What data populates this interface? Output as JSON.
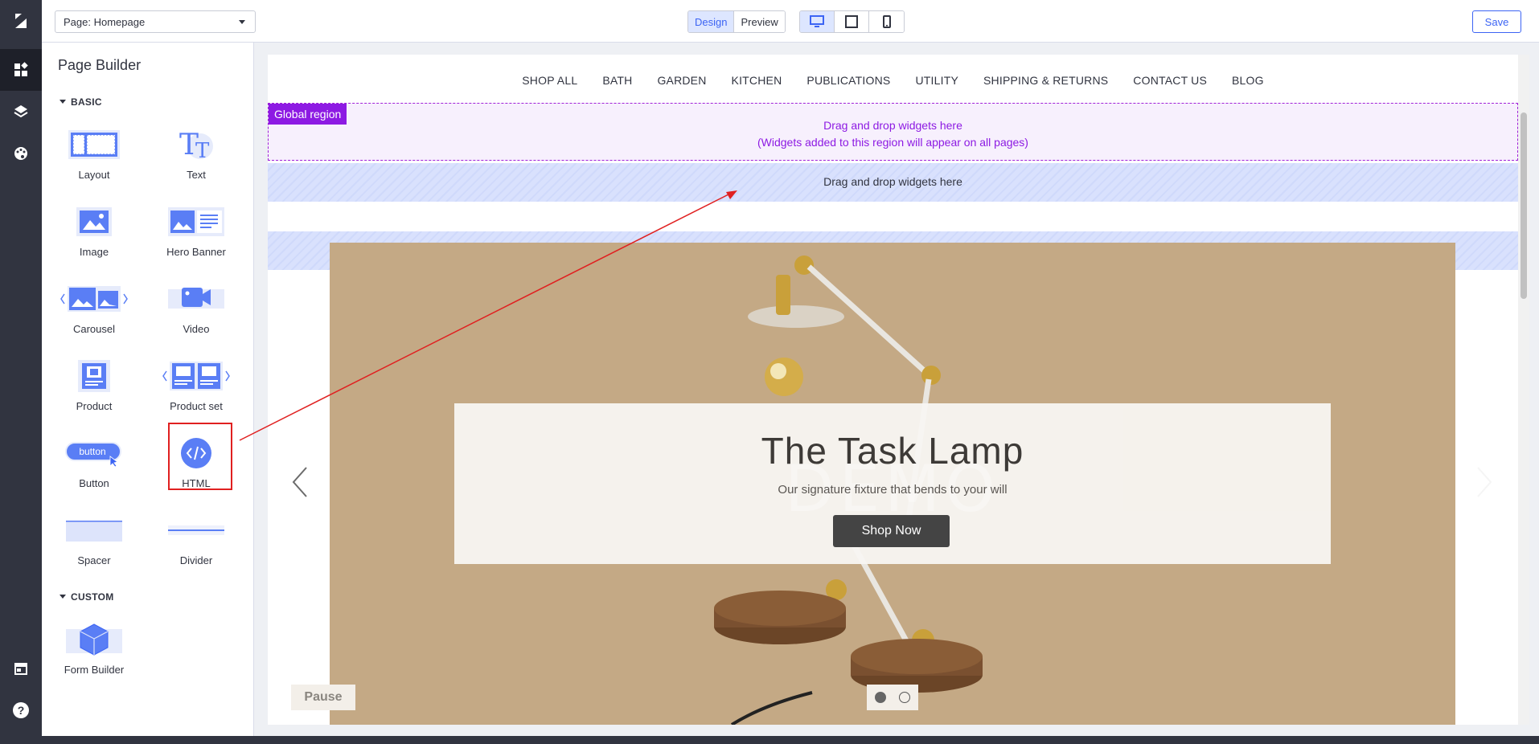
{
  "topbar": {
    "page_select": "Page: Homepage",
    "mode_design": "Design",
    "mode_preview": "Preview",
    "save": "Save",
    "devices": [
      "desktop-icon",
      "tablet-icon",
      "mobile-icon"
    ]
  },
  "rail": {
    "icons": [
      "bigcommerce-logo-icon",
      "widgets-icon",
      "layers-icon",
      "palette-icon",
      "storefront-icon",
      "help-icon"
    ]
  },
  "sidebar": {
    "title": "Page Builder",
    "basic_section": "BASIC",
    "custom_section": "CUSTOM",
    "widgets": {
      "layout": "Layout",
      "text": "Text",
      "image": "Image",
      "hero_banner": "Hero Banner",
      "carousel": "Carousel",
      "video": "Video",
      "product": "Product",
      "product_set": "Product set",
      "button": "Button",
      "button_icon_text": "button",
      "html": "HTML",
      "spacer": "Spacer",
      "divider": "Divider",
      "form_builder": "Form Builder"
    }
  },
  "canvas": {
    "nav": [
      "SHOP ALL",
      "BATH",
      "GARDEN",
      "KITCHEN",
      "PUBLICATIONS",
      "UTILITY",
      "SHIPPING & RETURNS",
      "CONTACT US",
      "BLOG"
    ],
    "global_tag": "Global region",
    "global_line1": "Drag and drop widgets here",
    "global_line2": "(Widgets added to this region will appear on all pages)",
    "drop_text": "Drag and drop widgets here",
    "hero": {
      "watermark": "DEMO",
      "title": "The Task Lamp",
      "subtitle": "Our signature fixture that bends to your will",
      "button": "Shop Now",
      "pause": "Pause",
      "active_slide": 1,
      "slide_count": 2
    }
  },
  "colors": {
    "accent": "#3c64f4",
    "global_region": "#8d1ae3",
    "highlight": "#e02020",
    "hero_bg": "#c4a985"
  }
}
